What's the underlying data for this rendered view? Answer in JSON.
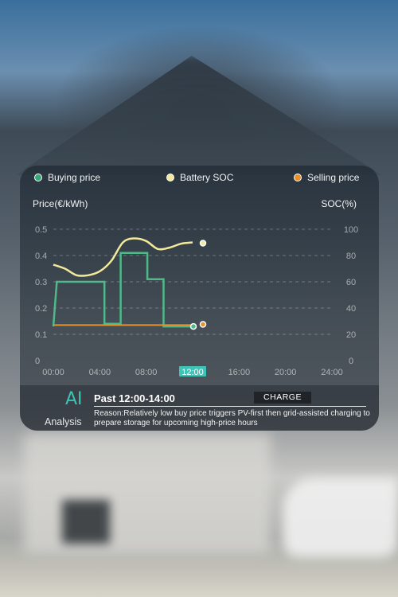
{
  "legend": [
    {
      "label": "Buying price",
      "color": "#3aa77c"
    },
    {
      "label": "Battery SOC",
      "color": "#f2ea9a"
    },
    {
      "label": "Selling price",
      "color": "#e8902a"
    }
  ],
  "axes": {
    "left_title": "Price(€/kWh)",
    "right_title": "SOC(%)"
  },
  "chart_data": {
    "type": "line",
    "x_ticks": [
      "00:00",
      "04:00",
      "08:00",
      "12:00",
      "16:00",
      "20:00",
      "24:00"
    ],
    "x_range": [
      0,
      24
    ],
    "highlighted_tick": "12:00",
    "y_left": {
      "ticks": [
        "0",
        "0.1",
        "0.2",
        "0.3",
        "0.4",
        "0.5"
      ],
      "range": [
        0,
        0.5
      ]
    },
    "y_right": {
      "ticks": [
        "0",
        "20",
        "40",
        "60",
        "80",
        "100"
      ],
      "range": [
        0,
        100
      ]
    },
    "grid": true,
    "series": [
      {
        "name": "Buying price",
        "color": "#4fb98a",
        "axis": "left",
        "step": true,
        "points": [
          [
            0,
            0.13
          ],
          [
            0.3,
            0.3
          ],
          [
            4.4,
            0.3
          ],
          [
            4.4,
            0.14
          ],
          [
            5.8,
            0.14
          ],
          [
            5.8,
            0.41
          ],
          [
            8.1,
            0.41
          ],
          [
            8.1,
            0.31
          ],
          [
            9.5,
            0.31
          ],
          [
            9.5,
            0.13
          ],
          [
            12,
            0.13
          ]
        ]
      },
      {
        "name": "Battery SOC",
        "color": "#f2ea9a",
        "axis": "right",
        "points": [
          [
            0,
            73
          ],
          [
            1,
            70
          ],
          [
            2,
            65
          ],
          [
            3,
            65
          ],
          [
            4,
            68
          ],
          [
            5,
            76
          ],
          [
            6,
            90
          ],
          [
            7,
            93
          ],
          [
            8,
            91
          ],
          [
            9,
            85
          ],
          [
            10,
            86
          ],
          [
            11,
            89
          ],
          [
            12,
            90
          ]
        ]
      },
      {
        "name": "Selling price",
        "color": "#e8902a",
        "axis": "left",
        "points": [
          [
            0,
            0.135
          ],
          [
            12,
            0.135
          ]
        ]
      }
    ]
  },
  "analysis": {
    "ai_label": "AI",
    "ai_sublabel": "Analysis",
    "window": "Past 12:00-14:00",
    "mode": "CHARGE",
    "reason": "Reason:Relatively low buy price triggers PV-first then grid-assisted charging to prepare storage for upcoming high-price hours"
  }
}
